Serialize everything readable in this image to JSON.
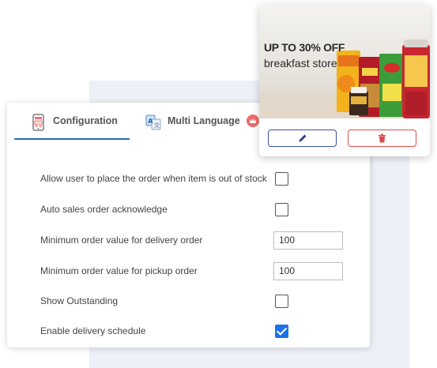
{
  "tabs": [
    {
      "label": "Configuration",
      "icon": "phone-cart-icon",
      "active": true
    },
    {
      "label": "Multi Language",
      "icon": "translate-icon",
      "badge_icon": "crown-badge-icon"
    }
  ],
  "settings": [
    {
      "label": "Allow user to place the order when item is out of stock",
      "type": "checkbox",
      "checked": false
    },
    {
      "label": "Auto sales order acknowledge",
      "type": "checkbox",
      "checked": false
    },
    {
      "label": "Minimum order value for delivery order",
      "type": "input",
      "value": "100"
    },
    {
      "label": "Minimum order value for pickup order",
      "type": "input",
      "value": "100"
    },
    {
      "label": "Show Outstanding",
      "type": "checkbox",
      "checked": false
    },
    {
      "label": "Enable delivery schedule",
      "type": "checkbox",
      "checked": true
    }
  ],
  "promo": {
    "headline": "UP TO 30% OFF",
    "subline": "breakfast store",
    "edit_icon": "pencil-icon",
    "delete_icon": "trash-icon"
  },
  "colors": {
    "accent": "#1a73e8",
    "edit_border": "#3b4fa3",
    "delete_red": "#e04b4b",
    "badge_red": "#f06a6a"
  }
}
